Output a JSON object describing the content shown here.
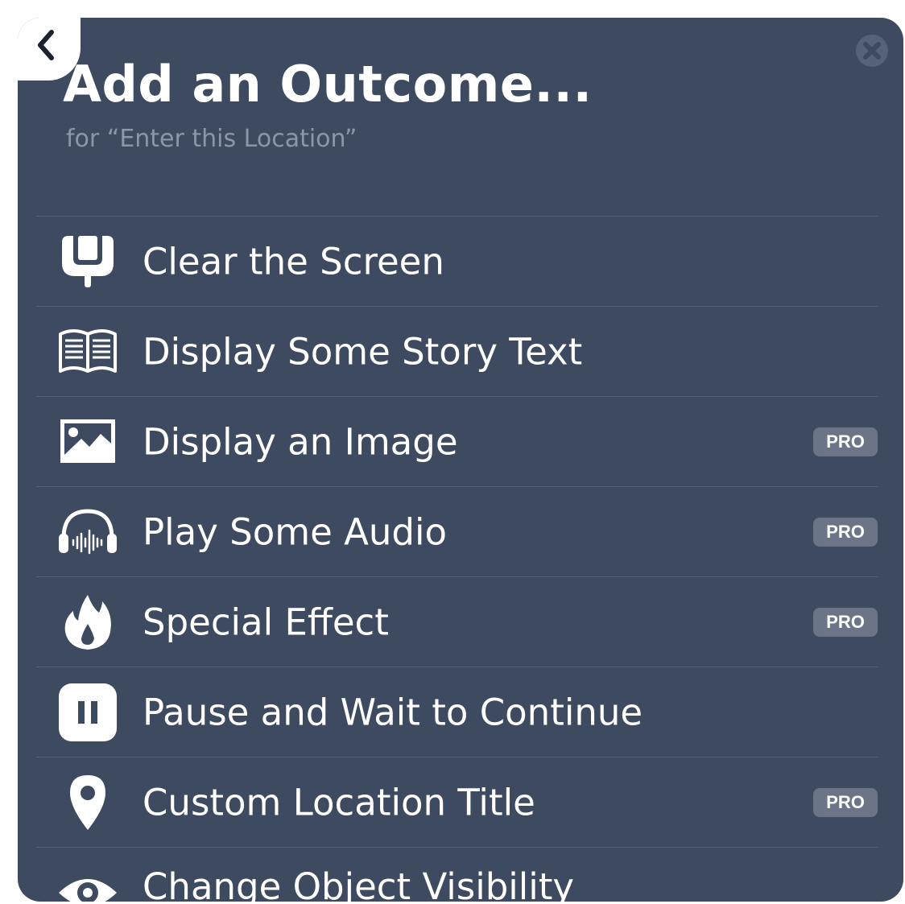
{
  "header": {
    "title": "Add an Outcome...",
    "subtitle": "for “Enter this Location”"
  },
  "items": [
    {
      "label": "Clear the Screen",
      "icon": "broom-icon",
      "badge": ""
    },
    {
      "label": "Display Some Story Text",
      "icon": "book-icon",
      "badge": ""
    },
    {
      "label": "Display an Image",
      "icon": "image-icon",
      "badge": "PRO"
    },
    {
      "label": "Play Some Audio",
      "icon": "headphones-icon",
      "badge": "PRO"
    },
    {
      "label": "Special Effect",
      "icon": "fire-icon",
      "badge": "PRO"
    },
    {
      "label": "Pause and Wait to Continue",
      "icon": "pause-icon",
      "badge": ""
    },
    {
      "label": "Custom Location Title",
      "icon": "location-pin-icon",
      "badge": "PRO"
    },
    {
      "label": "Change Object Visibility",
      "icon": "eye-icon",
      "badge": ""
    }
  ],
  "colors": {
    "panel": "#3d4a60",
    "divider": "#56627a",
    "subtitle": "#8d96a7",
    "badge": "#6c7587"
  }
}
